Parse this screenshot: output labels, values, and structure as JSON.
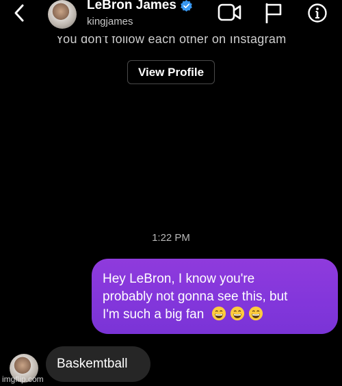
{
  "header": {
    "contact_name": "LeBron James",
    "username": "kingjames",
    "verified": true,
    "icons": [
      "back-icon",
      "video-call-icon",
      "flag-icon",
      "info-icon"
    ]
  },
  "notice": {
    "follow_text": "You don't follow each other on Instagram",
    "view_profile_label": "View Profile"
  },
  "conversation": {
    "timestamp": "1:22 PM",
    "outgoing": {
      "lines": [
        "Hey LeBron, I know you're",
        "probably not gonna see this, but",
        "I'm such a big fan"
      ],
      "emoji": [
        "grinning-face-icon",
        "grinning-face-icon",
        "grinning-face-icon"
      ]
    },
    "incoming": {
      "text": "Baskemtball"
    }
  },
  "colors": {
    "background": "#000000",
    "outgoing_bubble": "#8338DB",
    "incoming_bubble": "#262626",
    "verified_badge": "#3897F0"
  },
  "watermark": "imgflip.com"
}
